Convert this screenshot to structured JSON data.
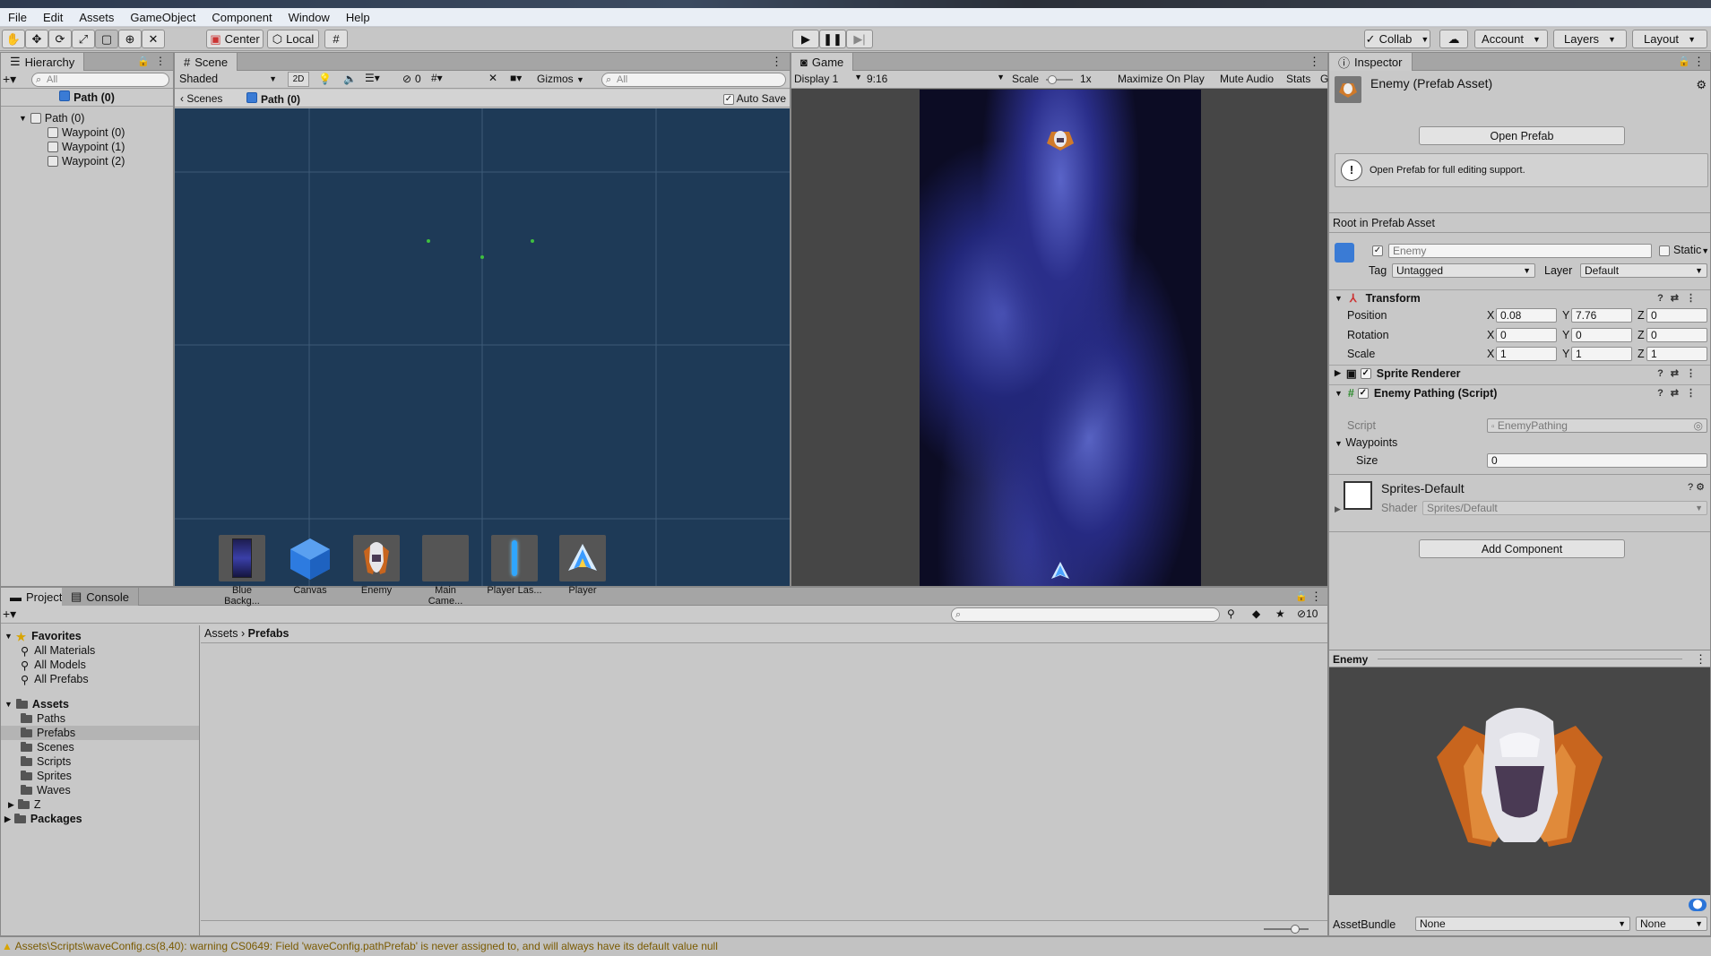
{
  "menu": [
    "File",
    "Edit",
    "Assets",
    "GameObject",
    "Component",
    "Window",
    "Help"
  ],
  "toolbar": {
    "center": "Center",
    "local": "Local",
    "collab": "Collab",
    "account": "Account",
    "layers": "Layers",
    "layout": "Layout"
  },
  "hierarchy": {
    "tab": "Hierarchy",
    "search": "All",
    "scene_title": "Path (0)",
    "items": [
      "Path (0)",
      "Waypoint (0)",
      "Waypoint (1)",
      "Waypoint (2)"
    ]
  },
  "scene": {
    "tab": "Scene",
    "shading": "Shaded",
    "mode2d": "2D",
    "hidden_count": "0",
    "gizmos": "Gizmos",
    "search": "All",
    "breadcrumb_scenes": "Scenes",
    "breadcrumb_prefab": "Path (0)",
    "autosave": "Auto Save"
  },
  "game": {
    "tab": "Game",
    "display": "Display 1",
    "aspect": "9:16",
    "scale_label": "Scale",
    "scale_value": "1x",
    "maximize": "Maximize On Play",
    "mute": "Mute Audio",
    "stats": "Stats",
    "gizmos": "G"
  },
  "inspector": {
    "tab": "Inspector",
    "title": "Enemy (Prefab Asset)",
    "open_prefab": "Open Prefab",
    "info": "Open Prefab for full editing support.",
    "root": "Root in Prefab Asset",
    "name": "Enemy",
    "static": "Static",
    "tag_label": "Tag",
    "tag": "Untagged",
    "layer_label": "Layer",
    "layer": "Default",
    "transform": {
      "title": "Transform",
      "rows": [
        {
          "label": "Position",
          "x": "0.08",
          "y": "7.76",
          "z": "0"
        },
        {
          "label": "Rotation",
          "x": "0",
          "y": "0",
          "z": "0"
        },
        {
          "label": "Scale",
          "x": "1",
          "y": "1",
          "z": "1"
        }
      ]
    },
    "axis": {
      "x": "X",
      "y": "Y",
      "z": "Z"
    },
    "sprite_renderer": "Sprite Renderer",
    "enemy_pathing": {
      "title": "Enemy Pathing (Script)",
      "script_label": "Script",
      "script": "EnemyPathing",
      "waypoints": "Waypoints",
      "size_label": "Size",
      "size": "0"
    },
    "material": {
      "name": "Sprites-Default",
      "shader_label": "Shader",
      "shader": "Sprites/Default"
    },
    "add_component": "Add Component",
    "preview_title": "Enemy",
    "assetbundle_label": "AssetBundle",
    "assetbundle": "None",
    "variant": "None"
  },
  "project": {
    "tab": "Project",
    "console_tab": "Console",
    "hidden_count": "10",
    "favorites": "Favorites",
    "fav_items": [
      "All Materials",
      "All Models",
      "All Prefabs"
    ],
    "assets": "Assets",
    "folders": [
      "Paths",
      "Prefabs",
      "Scenes",
      "Scripts",
      "Sprites",
      "Waves",
      "Z"
    ],
    "packages": "Packages",
    "breadcrumb": [
      "Assets",
      "Prefabs"
    ],
    "items": [
      "Blue Backg...",
      "Canvas",
      "Enemy",
      "Main Came...",
      "Player Las...",
      "Player"
    ]
  },
  "status": "Assets\\Scripts\\waveConfig.cs(8,40): warning CS0649: Field 'waveConfig.pathPrefab' is never assigned to, and will always have its default value null"
}
